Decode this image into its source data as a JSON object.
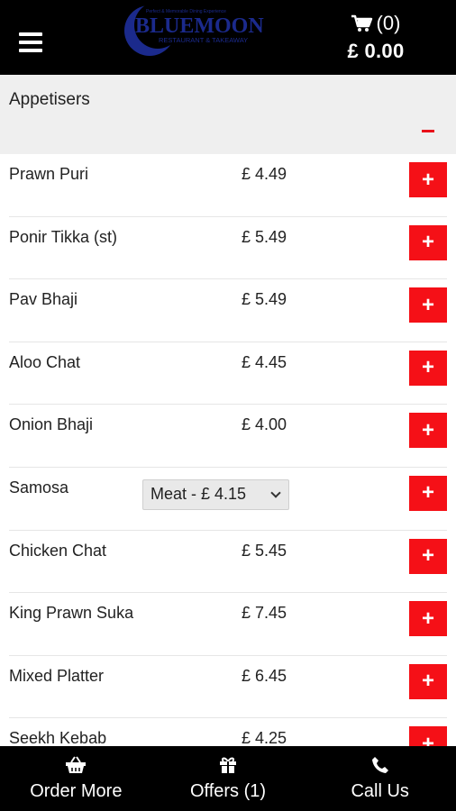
{
  "header": {
    "logo": {
      "tagline": "Perfect & Memorable Dining Experience",
      "name": "BLUEMOON",
      "subtitle": "RESTAURANT & TAKEAWAY"
    },
    "cart": {
      "count": "(0)",
      "total": "£ 0.00"
    }
  },
  "section": {
    "title": "Appetisers"
  },
  "items": [
    {
      "name": "Prawn Puri",
      "price": "£ 4.49"
    },
    {
      "name": "Ponir Tikka (st)",
      "price": "£ 5.49"
    },
    {
      "name": "Pav Bhaji",
      "price": "£ 5.49"
    },
    {
      "name": "Aloo Chat",
      "price": "£ 4.45"
    },
    {
      "name": "Onion Bhaji",
      "price": "£ 4.00"
    },
    {
      "name": "Samosa",
      "variant": "Meat - £ 4.15"
    },
    {
      "name": "Chicken Chat",
      "price": "£ 5.45"
    },
    {
      "name": "King Prawn Suka",
      "price": "£ 7.45"
    },
    {
      "name": "Mixed Platter",
      "price": "£ 6.45"
    },
    {
      "name": "Seekh Kebab",
      "price": "£ 4.25"
    }
  ],
  "footer": {
    "order_more": "Order More",
    "offers": "Offers (1)",
    "call_us": "Call Us"
  },
  "colors": {
    "accent": "#f51017",
    "header_bg": "#000000",
    "logo_blue": "#1b2a8c"
  }
}
